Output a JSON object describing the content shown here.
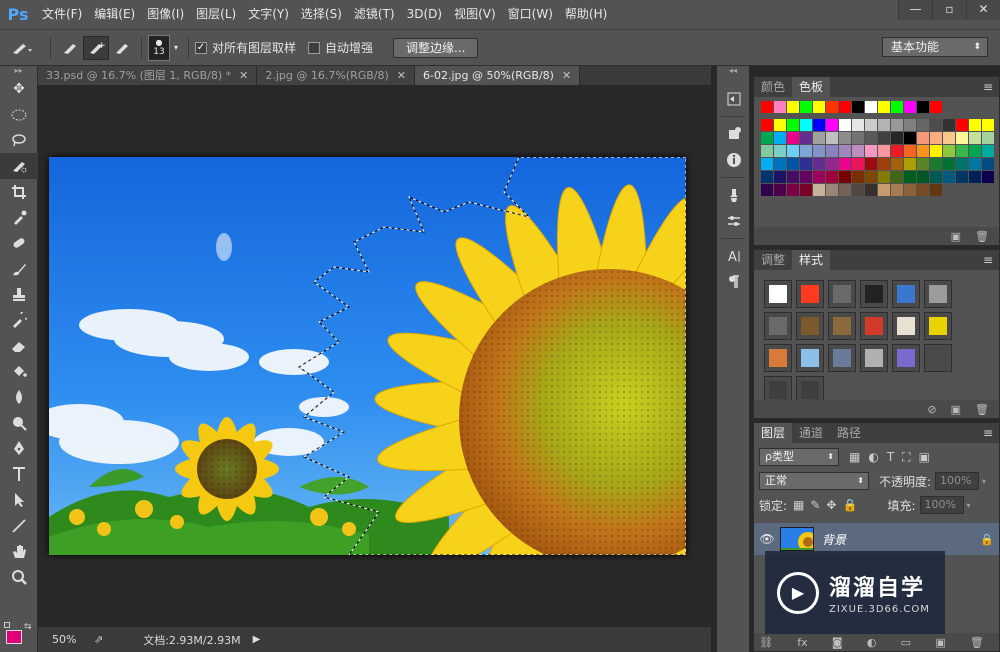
{
  "app": {
    "logo": "Ps",
    "menu": [
      "文件(F)",
      "编辑(E)",
      "图像(I)",
      "图层(L)",
      "文字(Y)",
      "选择(S)",
      "滤镜(T)",
      "3D(D)",
      "视图(V)",
      "窗口(W)",
      "帮助(H)"
    ],
    "window_controls": [
      "—",
      "▫",
      "✕"
    ]
  },
  "options_bar": {
    "brush_size": "13",
    "sample_all_layers": {
      "label": "对所有图层取样",
      "checked": true
    },
    "auto_enhance": {
      "label": "自动增强",
      "checked": false
    },
    "refine_edge_button": "调整边缘...",
    "workspace": "基本功能"
  },
  "tabs": [
    {
      "label": "33.psd @ 16.7% (图层 1, RGB/8) *",
      "active": false
    },
    {
      "label": "2.jpg @ 16.7%(RGB/8)",
      "active": false
    },
    {
      "label": "6-02.jpg @ 50%(RGB/8)",
      "active": true
    }
  ],
  "tools": [
    "move",
    "ellipse-marquee",
    "lasso",
    "quick-selection",
    "crop",
    "eyedropper",
    "healing",
    "brush",
    "clone-stamp",
    "history-brush",
    "eraser",
    "paint-bucket",
    "blur",
    "dodge",
    "pen",
    "type",
    "path-selection",
    "line",
    "hand",
    "zoom"
  ],
  "status": {
    "zoom": "50%",
    "doc_size": "文档:2.93M/2.93M"
  },
  "panels": {
    "color": {
      "tabs": [
        "颜色",
        "色板"
      ],
      "active": 1
    },
    "adjust": {
      "tabs": [
        "调整",
        "样式"
      ],
      "active": 1
    },
    "layers": {
      "tabs": [
        "图层",
        "通道",
        "路径"
      ],
      "active": 0,
      "kind_filter": "ρ类型",
      "blend_mode": "正常",
      "opacity_label": "不透明度:",
      "opacity_value": "100%",
      "lock_label": "锁定:",
      "fill_label": "填充:",
      "fill_value": "100%",
      "layer_name": "背景"
    }
  },
  "swatch_colors": {
    "row1": [
      "#ff0000",
      "#ff7fbf",
      "#ffff00",
      "#00ff00",
      "#ffff00",
      "#ff3300",
      "#ff0000",
      "#000000",
      "#ffffff",
      "#ffff00",
      "#00ff00",
      "#ff00ff",
      "#000000",
      "#ff0000"
    ],
    "rows": [
      [
        "#ff0000",
        "#ffff00",
        "#00ff00",
        "#00ffff",
        "#0000ff",
        "#ff00ff",
        "#ffffff",
        "#e6e6e6",
        "#cccccc",
        "#b3b3b3",
        "#999999",
        "#808080",
        "#666666",
        "#4d4d4d",
        "#333333",
        "#ff0000",
        "#ffff00",
        "#ffff00"
      ],
      [
        "#00a651",
        "#00aeef",
        "#ec008c",
        "#662d91",
        "#a0a0a0",
        "#bfbfbf",
        "#8c8c8c",
        "#737373",
        "#595959",
        "#404040",
        "#262626",
        "#000000",
        "#f7977a",
        "#f9ad81",
        "#fdc68a",
        "#fff79a",
        "#c4df9b",
        "#a3d39c"
      ],
      [
        "#82ca9d",
        "#7bcdc8",
        "#6ecff6",
        "#7ea7d8",
        "#8493ca",
        "#8882be",
        "#a187be",
        "#bc8dbf",
        "#f49ac2",
        "#f6989d",
        "#ed1c24",
        "#f26522",
        "#f7941d",
        "#fff200",
        "#8dc73f",
        "#39b54a",
        "#00a651",
        "#00a99d"
      ],
      [
        "#00aeef",
        "#0072bc",
        "#0054a6",
        "#2e3192",
        "#662d91",
        "#92278f",
        "#ec008c",
        "#ed145b",
        "#9e0b0f",
        "#a0410d",
        "#a36209",
        "#aba000",
        "#598527",
        "#1a7b30",
        "#007236",
        "#00746b",
        "#0076a3",
        "#004b80"
      ],
      [
        "#003471",
        "#1b1464",
        "#440e62",
        "#630460",
        "#9e005d",
        "#9e0039",
        "#790000",
        "#7b2e00",
        "#7d4900",
        "#827b00",
        "#406618",
        "#005e20",
        "#005826",
        "#005952",
        "#005b7f",
        "#003663",
        "#002157",
        "#0d004c"
      ],
      [
        "#32004b",
        "#4b0049",
        "#7b0046",
        "#7a0026",
        "#c7b299",
        "#998675",
        "#736357",
        "#534741",
        "#37302d",
        "#c69c6d",
        "#a67c52",
        "#8c6239",
        "#754c24",
        "#603913"
      ]
    ]
  },
  "styles": [
    [
      "#ffffff",
      "#ff3b1f",
      "#6a6a6a",
      "#222222",
      "#3a78d0",
      "#9b9b9b",
      "#6a6a6a"
    ],
    [
      "#7a5a2a",
      "#8a6a3a",
      "#d43a2a",
      "#e8e0d0",
      "#e8d200",
      "#d87a3a",
      "#8ac0e8"
    ],
    [
      "#6a7a9a",
      "#b0b0b0",
      "#7a6ad0",
      "#4a4a4a",
      "#3e3e3e",
      "#3e3e3e"
    ]
  ],
  "watermark": {
    "title": "溜溜自学",
    "subtitle": "ZIXUE.3D66.COM"
  }
}
